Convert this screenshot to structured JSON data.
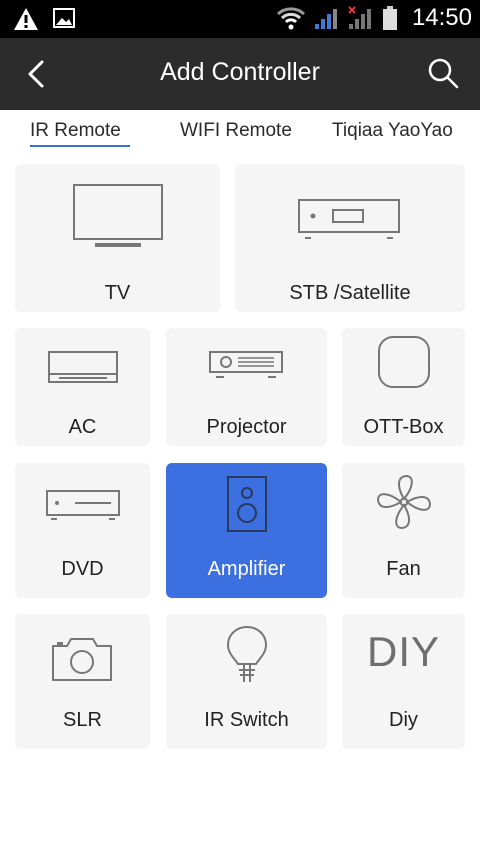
{
  "status_bar": {
    "time": "14:50",
    "icons": [
      "warning-icon",
      "image-icon",
      "wifi-icon",
      "signal-icon",
      "signal-off-icon",
      "battery-icon"
    ]
  },
  "app_bar": {
    "title": "Add Controller",
    "back_icon": "chevron-left-icon",
    "search_icon": "search-icon"
  },
  "tabs": [
    {
      "label": "IR Remote",
      "selected": true
    },
    {
      "label": "WIFI Remote",
      "selected": false
    },
    {
      "label": "Tiqiaa YaoYao",
      "selected": false
    }
  ],
  "devices": [
    {
      "label": "TV",
      "icon": "tv-icon"
    },
    {
      "label": "STB /Satellite",
      "icon": "set-top-box-icon"
    },
    {
      "label": "AC",
      "icon": "air-conditioner-icon"
    },
    {
      "label": "Projector",
      "icon": "projector-icon"
    },
    {
      "label": "OTT-Box",
      "icon": "ott-box-icon"
    },
    {
      "label": "DVD",
      "icon": "dvd-player-icon"
    },
    {
      "label": "Amplifier",
      "icon": "speaker-icon",
      "selected": true
    },
    {
      "label": "Fan",
      "icon": "fan-icon"
    },
    {
      "label": "SLR",
      "icon": "camera-icon"
    },
    {
      "label": "IR Switch",
      "icon": "light-bulb-icon"
    },
    {
      "label": "Diy",
      "icon": "diy-icon",
      "icon_text": "DIY"
    }
  ],
  "colors": {
    "accent": "#3c6fe0",
    "app_bar": "#2c2c2c",
    "tile": "#f5f5f5",
    "icon_stroke": "#777777"
  }
}
